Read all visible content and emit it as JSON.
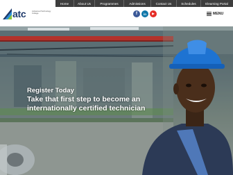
{
  "nav": {
    "items": [
      {
        "label": "Home"
      },
      {
        "label": "About Us"
      },
      {
        "label": "Programmes"
      },
      {
        "label": "Admissions"
      },
      {
        "label": "Contact Us"
      },
      {
        "label": "Schedules"
      },
      {
        "label": "Elearning Portal"
      }
    ]
  },
  "logo": {
    "brand": "atc",
    "subtitle": "Advanced Technology College"
  },
  "social": {
    "facebook": "f",
    "linkedin": "in",
    "youtube": "▶"
  },
  "menu": {
    "label": "MENU"
  },
  "hero": {
    "line1": "Register Today",
    "line2": "Take that first step to become an",
    "line3": "internationally certified technician"
  },
  "colors": {
    "nav_bg": "#3d3d3d",
    "brand_blue": "#1f3a6b",
    "facebook": "#3b5998",
    "linkedin": "#0e76a8",
    "youtube": "#e52d27",
    "helmet_blue": "#1e73d2"
  }
}
